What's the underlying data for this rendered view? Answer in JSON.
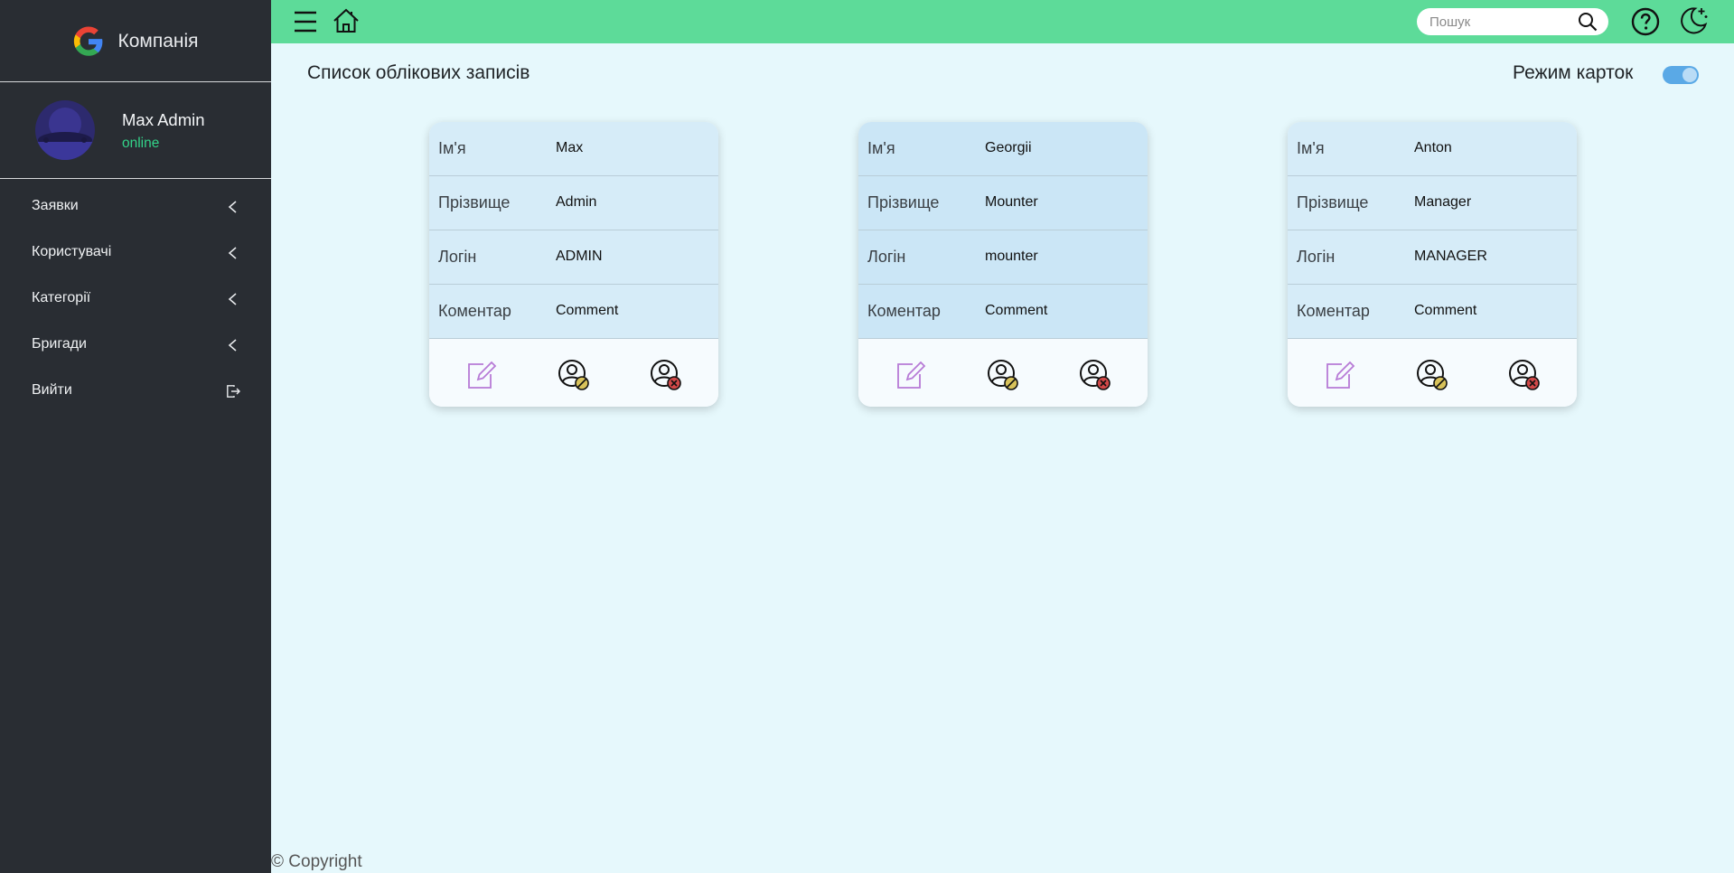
{
  "brand": {
    "name": "Компанія",
    "icon": "google-logo"
  },
  "user": {
    "name": "Max Admin",
    "status": "online"
  },
  "menu": [
    {
      "label": "Заявки",
      "icon": "chevron-left-icon"
    },
    {
      "label": "Користувачі",
      "icon": "chevron-left-icon"
    },
    {
      "label": "Категорії",
      "icon": "chevron-left-icon"
    },
    {
      "label": "Бригади",
      "icon": "chevron-left-icon"
    },
    {
      "label": "Вийти",
      "icon": "logout-icon"
    }
  ],
  "topbar": {
    "icons": [
      "menu-icon",
      "home-icon",
      "help-icon",
      "theme-toggle-icon"
    ],
    "search": {
      "placeholder": "Пошук",
      "value": ""
    }
  },
  "page": {
    "title": "Список облікових записів",
    "card_mode_label": "Режим карток",
    "card_mode_on": true
  },
  "fields": {
    "first_name": "Ім'я",
    "last_name": "Прізвище",
    "login": "Логін",
    "comment": "Коментар"
  },
  "accounts": [
    {
      "first_name": "Max",
      "last_name": "Admin",
      "login": "ADMIN",
      "comment": "Comment"
    },
    {
      "first_name": "Georgii",
      "last_name": "Mounter",
      "login": "mounter",
      "comment": "Comment"
    },
    {
      "first_name": "Anton",
      "last_name": "Manager",
      "login": "MANAGER",
      "comment": "Comment"
    }
  ],
  "card_actions": [
    "edit-icon",
    "block-user-icon",
    "delete-user-icon"
  ],
  "footer": {
    "copyright": "© Copyright"
  },
  "colors": {
    "sidebar_bg": "#292d33",
    "topbar_bg": "#5ddb99",
    "page_bg": "#e6f8fc",
    "status_online": "#33d389",
    "toggle_on": "#5aa9e6",
    "edit_icon": "#b77ad6",
    "block_badge": "#d8c25a",
    "delete_badge": "#d04848"
  }
}
